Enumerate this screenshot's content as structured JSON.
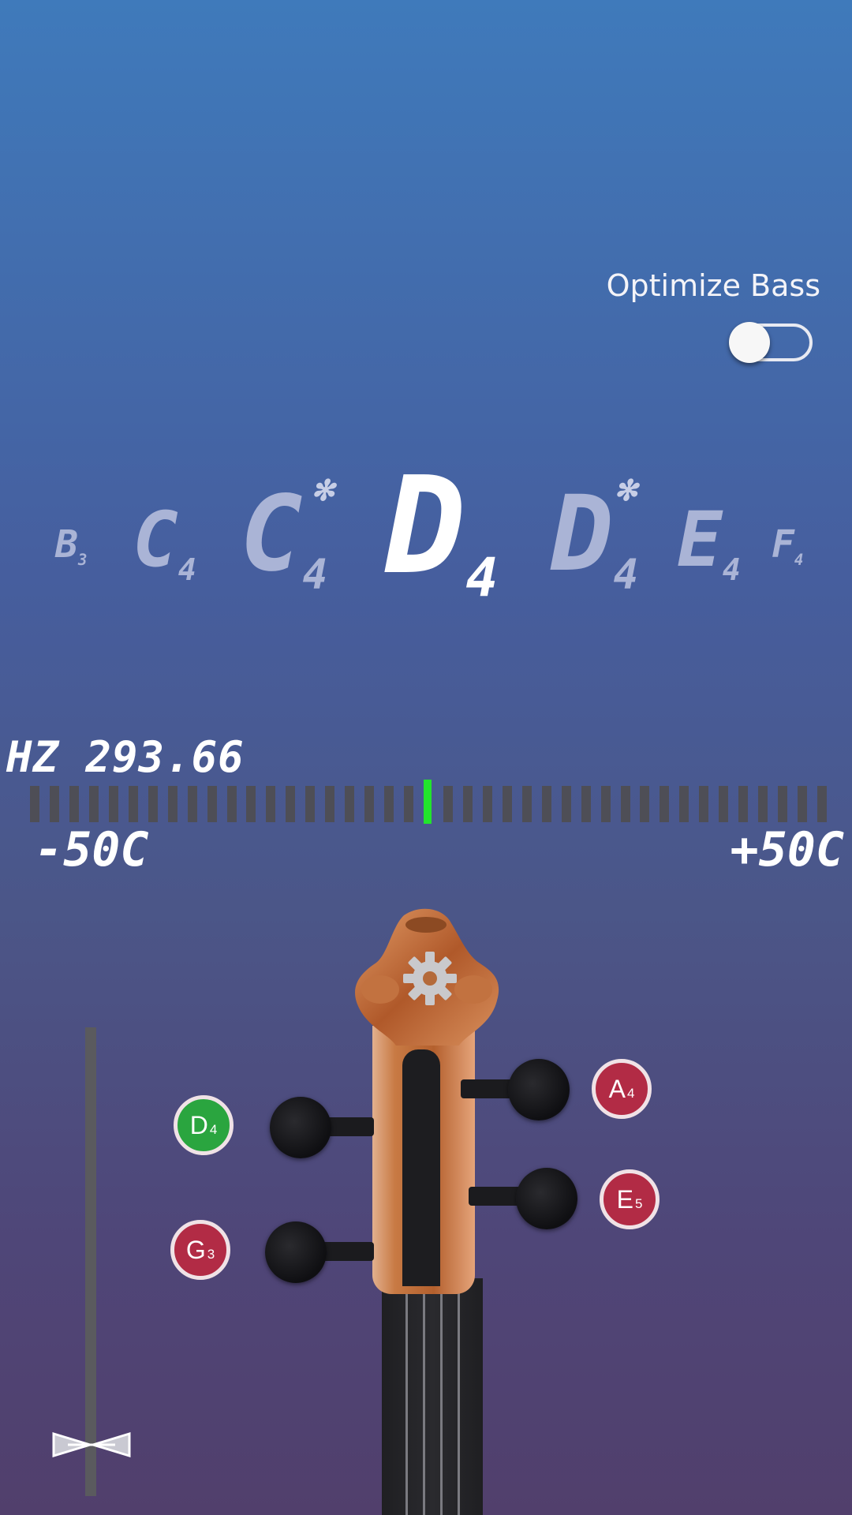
{
  "settings": {
    "optimize_bass_label": "Optimize Bass",
    "optimize_bass_on": false
  },
  "notes": [
    {
      "name": "B",
      "octave": "3",
      "sharp": false
    },
    {
      "name": "C",
      "octave": "4",
      "sharp": false
    },
    {
      "name": "C",
      "octave": "4",
      "sharp": true
    },
    {
      "name": "D",
      "octave": "4",
      "sharp": false,
      "active": true
    },
    {
      "name": "D",
      "octave": "4",
      "sharp": true
    },
    {
      "name": "E",
      "octave": "4",
      "sharp": false
    },
    {
      "name": "F",
      "octave": "4",
      "sharp": false
    }
  ],
  "tuner": {
    "frequency_text": "HZ 293.66",
    "cents_min_label": "-50C",
    "cents_max_label": "+50C",
    "cents_offset": 0,
    "in_tune_color": "#22e52c"
  },
  "strings": {
    "g": {
      "note": "G",
      "octave": "3",
      "selected": false
    },
    "d": {
      "note": "D",
      "octave": "4",
      "selected": true
    },
    "a": {
      "note": "A",
      "octave": "4",
      "selected": false
    },
    "e": {
      "note": "E",
      "octave": "5",
      "selected": false
    }
  },
  "colors": {
    "selected": "#2aa53f",
    "unselected": "#b22b45"
  },
  "icons": {
    "settings": "gear-icon",
    "slider_handle": "bowtie-handle-icon"
  }
}
